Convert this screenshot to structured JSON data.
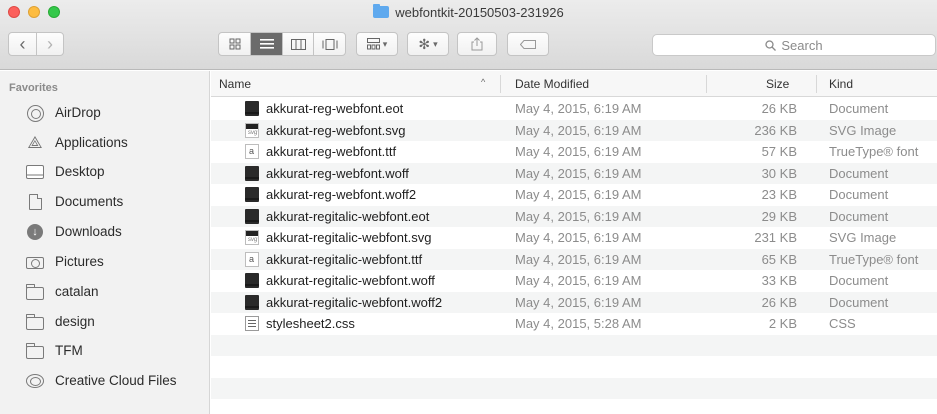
{
  "window": {
    "title": "webfontkit-20150503-231926"
  },
  "toolbar": {
    "back_glyph": "‹",
    "forward_glyph": "›",
    "view_icons": [
      "icon-view-icon",
      "list-view-icon",
      "column-view-icon",
      "coverflow-view-icon"
    ],
    "active_view": "list-view-icon",
    "arrange_glyph": "▾",
    "action_glyph": "▾",
    "search_placeholder": "Search"
  },
  "sidebar": {
    "heading": "Favorites",
    "items": [
      {
        "label": "AirDrop",
        "icon": "airdrop-icon"
      },
      {
        "label": "Applications",
        "icon": "applications-icon"
      },
      {
        "label": "Desktop",
        "icon": "desktop-icon"
      },
      {
        "label": "Documents",
        "icon": "documents-icon"
      },
      {
        "label": "Downloads",
        "icon": "downloads-icon"
      },
      {
        "label": "Pictures",
        "icon": "pictures-icon"
      },
      {
        "label": "catalan",
        "icon": "folder-icon"
      },
      {
        "label": "design",
        "icon": "folder-icon"
      },
      {
        "label": "TFM",
        "icon": "folder-icon"
      },
      {
        "label": "Creative Cloud Files",
        "icon": "creative-cloud-icon"
      }
    ]
  },
  "list": {
    "columns": {
      "name": "Name",
      "sort_indicator": "^",
      "date": "Date Modified",
      "size": "Size",
      "kind": "Kind"
    },
    "rows": [
      {
        "name": "akkurat-reg-webfont.eot",
        "date": "May 4, 2015, 6:19 AM",
        "size": "26 KB",
        "kind": "Document",
        "icon": "document-icon"
      },
      {
        "name": "akkurat-reg-webfont.svg",
        "date": "May 4, 2015, 6:19 AM",
        "size": "236 KB",
        "kind": "SVG Image",
        "icon": "svg-file-icon"
      },
      {
        "name": "akkurat-reg-webfont.ttf",
        "date": "May 4, 2015, 6:19 AM",
        "size": "57 KB",
        "kind": "TrueType® font",
        "icon": "font-file-icon"
      },
      {
        "name": "akkurat-reg-webfont.woff",
        "date": "May 4, 2015, 6:19 AM",
        "size": "30 KB",
        "kind": "Document",
        "icon": "document-icon"
      },
      {
        "name": "akkurat-reg-webfont.woff2",
        "date": "May 4, 2015, 6:19 AM",
        "size": "23 KB",
        "kind": "Document",
        "icon": "document-icon"
      },
      {
        "name": "akkurat-regitalic-webfont.eot",
        "date": "May 4, 2015, 6:19 AM",
        "size": "29 KB",
        "kind": "Document",
        "icon": "document-icon"
      },
      {
        "name": "akkurat-regitalic-webfont.svg",
        "date": "May 4, 2015, 6:19 AM",
        "size": "231 KB",
        "kind": "SVG Image",
        "icon": "svg-file-icon"
      },
      {
        "name": "akkurat-regitalic-webfont.ttf",
        "date": "May 4, 2015, 6:19 AM",
        "size": "65 KB",
        "kind": "TrueType® font",
        "icon": "font-file-icon"
      },
      {
        "name": "akkurat-regitalic-webfont.woff",
        "date": "May 4, 2015, 6:19 AM",
        "size": "33 KB",
        "kind": "Document",
        "icon": "document-icon"
      },
      {
        "name": "akkurat-regitalic-webfont.woff2",
        "date": "May 4, 2015, 6:19 AM",
        "size": "26 KB",
        "kind": "Document",
        "icon": "document-icon"
      },
      {
        "name": "stylesheet2.css",
        "date": "May 4, 2015, 5:28 AM",
        "size": "2 KB",
        "kind": "CSS",
        "icon": "css-file-icon"
      }
    ]
  },
  "colors": {
    "close": "#fc605c",
    "minimize": "#fdbc40",
    "zoom": "#34c84a",
    "title_folder": "#5fa9ee"
  }
}
